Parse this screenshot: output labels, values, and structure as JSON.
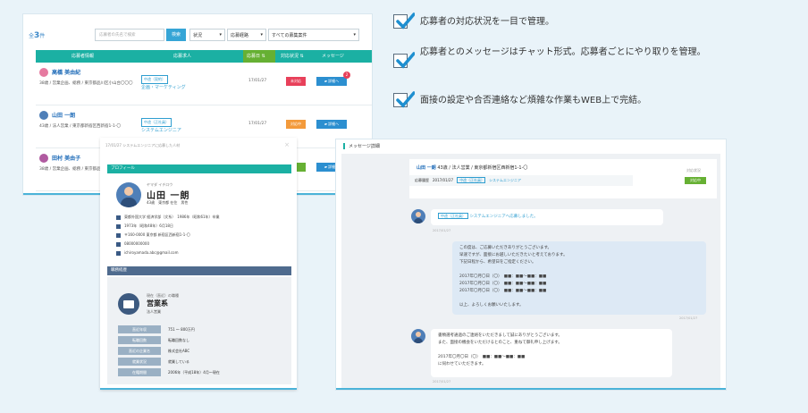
{
  "list": {
    "count_prefix": "全",
    "count_value": "3",
    "count_suffix": "件",
    "search_placeholder": "応募者の氏名で検索",
    "search_label": "検索",
    "filter_status": "状況",
    "filter_sort": "応募経路",
    "filter_jobs": "すべての募集案件",
    "headers": [
      "応募者情報",
      "応募求人",
      "応募日 ⇅",
      "対応状況 ⇅",
      "メッセージ"
    ],
    "rows": [
      {
        "name": "高橋 美由紀",
        "meta": "38歳 / 営業企画、総務 / 東京都品川区小山台〇〇〇",
        "tag": "中途（契約）",
        "job": "企画・マーケティング",
        "date": "17/01/27",
        "status": "未対応",
        "status_color": "#e8405a",
        "detail": "詳細へ",
        "badge": "2",
        "avatar_color": "#e67aa0"
      },
      {
        "name": "山田 一朗",
        "meta": "43歳 / 法人営業 / 東京都新宿区西新宿1-1-〇",
        "tag": "中途（正社員）",
        "job": "システムエンジニア",
        "date": "17/01/27",
        "status": "対応中",
        "status_color": "#f39a3b",
        "detail": "詳細へ",
        "badge": "",
        "avatar_color": "#4f7fb8"
      },
      {
        "name": "田村 美由子",
        "meta": "38歳 / 営業企画、総務 / 東京都品川区小山台2-4",
        "tag": "",
        "job": "",
        "date": "",
        "status": "",
        "status_color": "#66b033",
        "detail": "詳細へ",
        "badge": "",
        "avatar_color": "#b05aa0"
      }
    ]
  },
  "profile": {
    "top_note": "17/01/27 システムエンジニアに応募した人材",
    "section_profile": "プロフィール",
    "kana": "ヤマダ イチロウ",
    "name": "山田 一朗",
    "sub": "43歳　東京都 在住　男性",
    "lines": [
      "東都外国大学 経済学部（文系）　1986年（昭和61年）卒業",
      "1973年（昭和48年）6月18日",
      "〒160-0000 東京都 新宿区西新宿1-1-〇",
      "08000000000",
      "ichiroyamada.abc@gmail.com"
    ],
    "section_career": "職務経歴",
    "career_small": "現在（直近）の職種",
    "career_big": "営業系",
    "career_sub": "法人営業",
    "kv": [
      {
        "k": "直近年収",
        "v": "751 ～ 800万円"
      },
      {
        "k": "転職回数",
        "v": "転職回数なし"
      },
      {
        "k": "直近の企業名",
        "v": "株式会社ABC"
      },
      {
        "k": "就業状況",
        "v": "就業している"
      },
      {
        "k": "在籍期間",
        "v": "2006年（平成18年）4月～現在"
      }
    ]
  },
  "checklist": [
    "応募者の対応状況を一目で管理。",
    "応募者とのメッセージはチャット形式。応募者ごとにやり取りを管理。",
    "面接の設定や合否連絡など煩雑な作業もWEB上で完結。"
  ],
  "messages": {
    "title": "メッセージ詳細",
    "hdr_name": "山田 一朗",
    "hdr_meta": "43歳 / 法人営業 / 東京都新宿区西新宿1-1-〇",
    "hdr_label": "応募履歴",
    "hdr_date": "2017/01/27",
    "hdr_tag": "中途（正社員）",
    "hdr_job": "システムエンジニア",
    "hdr_status_label": "対応状況",
    "hdr_status": "対応中",
    "bubble1_tag": "中途（正社員）",
    "bubble1_text": "システムエンジニアへ応募しました。",
    "stamp1": "2017/01/27",
    "bubble2_lines": [
      "この度は、ご応募いただきありがとうございます。",
      "早速ですが、面接にお越しいただきたいと考えております。",
      "下記日程から、希望日をご指定ください。",
      "",
      "2017年〇月〇日（〇）　■■：■■～■■：■■",
      "2017年〇月〇日（〇）　■■：■■～■■：■■",
      "2017年〇月〇日（〇）　■■：■■～■■：■■",
      "",
      "以上、よろしくお願いいたします。"
    ],
    "stamp2": "2017/01/27",
    "bubble3_lines": [
      "書類選考通過のご連絡をいただきまして誠にありがとうございます。",
      "また、面接の機会をいただけるとのこと、重ねて御礼申し上げます。",
      "",
      "2017年〇月〇日（〇）　■■：■■～■■：■■",
      "に伺わせていただきます。"
    ],
    "stamp3": "2017/01/27"
  }
}
